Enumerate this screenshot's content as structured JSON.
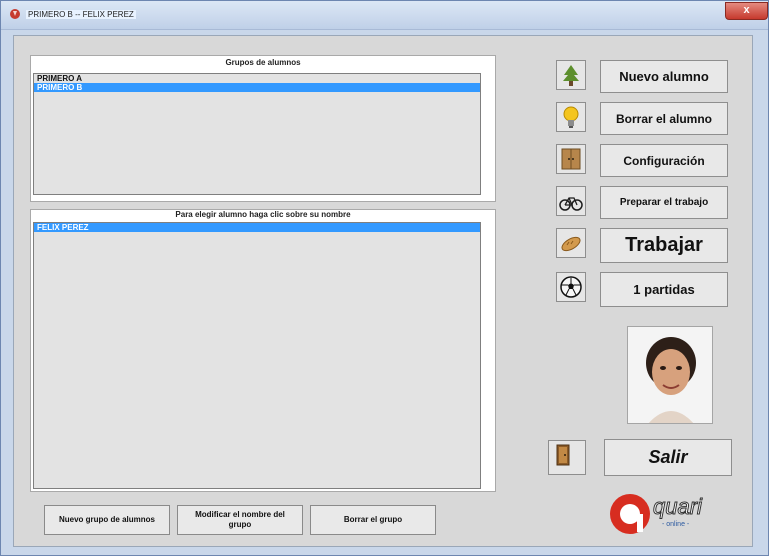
{
  "window": {
    "title": "PRIMERO B -- FELIX PEREZ",
    "close_label": "x"
  },
  "groups": {
    "title": "Grupos de alumnos",
    "items": [
      "PRIMERO A",
      "PRIMERO B"
    ],
    "selected_index": 1
  },
  "students": {
    "title": "Para elegir alumno haga clic sobre su nombre",
    "items": [
      "FELIX PEREZ"
    ],
    "selected_index": 0
  },
  "bottom_buttons": {
    "new_group": "Nuevo grupo de alumnos",
    "rename_group": "Modificar el nombre del grupo",
    "delete_group": "Borrar el grupo"
  },
  "actions": {
    "new_student": "Nuevo alumno",
    "delete_student": "Borrar el alumno",
    "settings": "Configuración",
    "prepare_work": "Preparar el trabajo",
    "work": "Trabajar",
    "games": "1 partidas",
    "exit": "Salir"
  },
  "logo": {
    "text": "quari",
    "subtext": "- online -"
  },
  "icons": {
    "tree": "tree-icon",
    "bulb": "light-bulb-icon",
    "door": "cabinet-door-icon",
    "bike": "bicycle-icon",
    "bread": "bread-icon",
    "ball": "soccer-ball-icon",
    "exit": "exit-door-icon"
  }
}
